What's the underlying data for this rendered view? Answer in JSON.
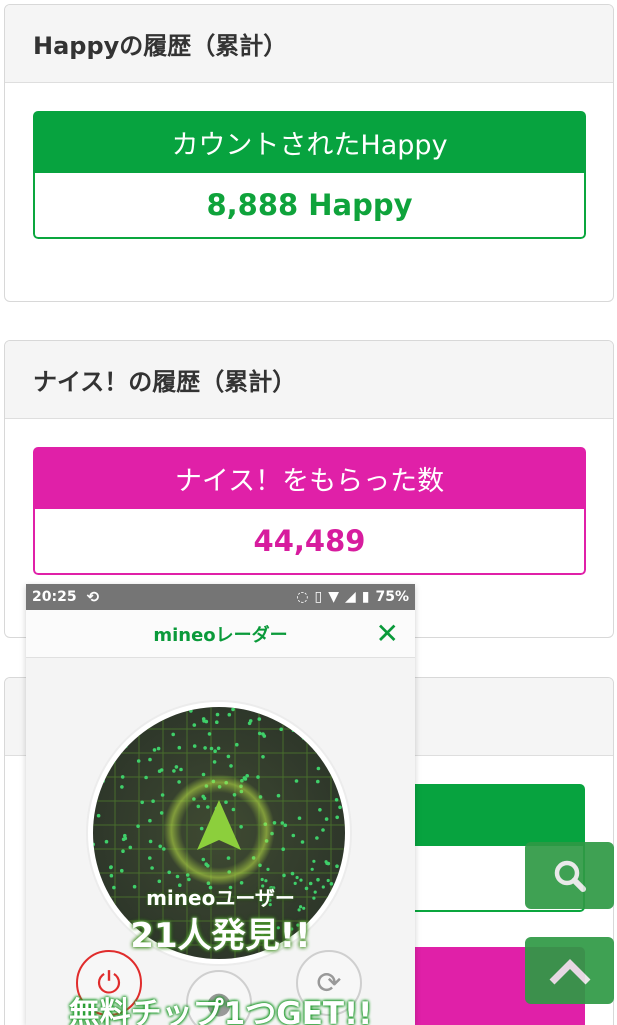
{
  "happy_card": {
    "title": "Happyの履歴（累計）",
    "label": "カウントされたHappy",
    "value": "8,888 Happy"
  },
  "nice_card": {
    "title": "ナイス！の履歴（累計）",
    "label": "ナイス！をもらった数",
    "value": "44,489"
  },
  "popup": {
    "status_time": "20:25",
    "status_battery": "75%",
    "title": "mineoレーダー",
    "found_sub": "mineoユーザー",
    "found_main": "21人発見!!",
    "free_chip": "無料チップ1つGET!!"
  },
  "colors": {
    "green": "#07a33f",
    "pink": "#e020a8",
    "fab": "#2f9a45"
  },
  "icons": {
    "close": "close-icon",
    "search": "search-icon",
    "scroll_top": "chevron-up-icon",
    "power": "power-icon",
    "refresh": "refresh-icon"
  }
}
